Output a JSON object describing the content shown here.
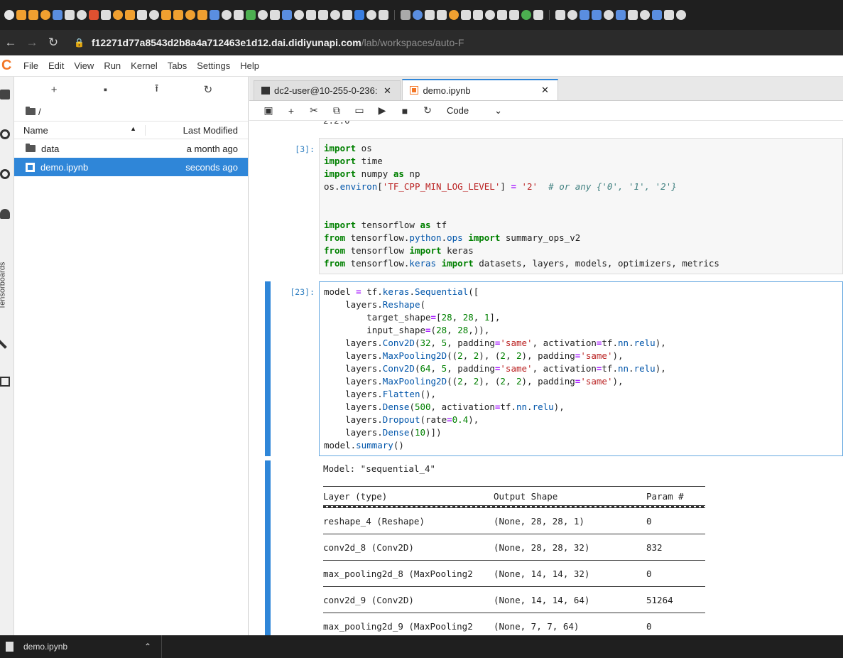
{
  "browser": {
    "url_host": "f12271d77a8543d2b8a4a712463e1d12.dai.didiyunapi.com",
    "url_path": "/lab/workspaces/auto-F",
    "tab_favicon_colors": [
      "#e6e6e6",
      "#f0a030",
      "#f0a030",
      "#f0a030",
      "#5a8ee0",
      "#ddd",
      "#ddd",
      "#e05030",
      "#ddd",
      "#f0a030",
      "#f0a030",
      "#ddd",
      "#ddd",
      "#f0a030",
      "#f0a030",
      "#f0a030",
      "#f0a030",
      "#5a8ee0",
      "#ddd",
      "#ddd",
      "#4caf50",
      "#ddd",
      "#ddd",
      "#5a8ee0",
      "#ddd",
      "#ddd",
      "#ddd",
      "#ddd",
      "#ddd",
      "#3a7ee0",
      "#ddd",
      "#ddd",
      "#aaa",
      "#5a8ee0",
      "#ddd",
      "#ddd",
      "#f0a030",
      "#ddd",
      "#ddd",
      "#ddd",
      "#ddd",
      "#ddd",
      "#4caf50",
      "#ddd",
      "#ddd",
      "#ddd",
      "#5a8ee0",
      "#5a8ee0",
      "#ddd",
      "#5a8ee0",
      "#ddd",
      "#ddd",
      "#5a8ee0",
      "#ddd",
      "#ddd"
    ]
  },
  "menubar": {
    "items": [
      "File",
      "Edit",
      "View",
      "Run",
      "Kernel",
      "Tabs",
      "Settings",
      "Help"
    ]
  },
  "activitybar": {
    "tensorboards_label": "Tensorboards"
  },
  "filebrowser": {
    "breadcrumb": "/",
    "col_name": "Name",
    "col_modified": "Last Modified",
    "rows": [
      {
        "name": "data",
        "modified": "a month ago"
      },
      {
        "name": "demo.ipynb",
        "modified": "seconds ago"
      }
    ]
  },
  "tabs": [
    {
      "label": "dc2-user@10-255-0-236:"
    },
    {
      "label": "demo.ipynb"
    }
  ],
  "toolbar": {
    "cell_type": "Code"
  },
  "cells": {
    "prev_output_tail": "2.2.0",
    "cell3_prompt": "[3]:",
    "cell23_prompt": "[23]:"
  },
  "output": {
    "model_name": "Model: \"sequential_4\"",
    "headers": [
      "Layer (type)",
      "Output Shape",
      "Param #"
    ],
    "rows": [
      [
        "reshape_4 (Reshape)",
        "(None, 28, 28, 1)",
        "0"
      ],
      [
        "conv2d_8 (Conv2D)",
        "(None, 28, 28, 32)",
        "832"
      ],
      [
        "max_pooling2d_8 (MaxPooling2",
        "(None, 14, 14, 32)",
        "0"
      ],
      [
        "conv2d_9 (Conv2D)",
        "(None, 14, 14, 64)",
        "51264"
      ],
      [
        "max_pooling2d_9 (MaxPooling2",
        "(None, 7, 7, 64)",
        "0"
      ]
    ]
  },
  "downloadbar": {
    "filename": "demo.ipynb"
  }
}
